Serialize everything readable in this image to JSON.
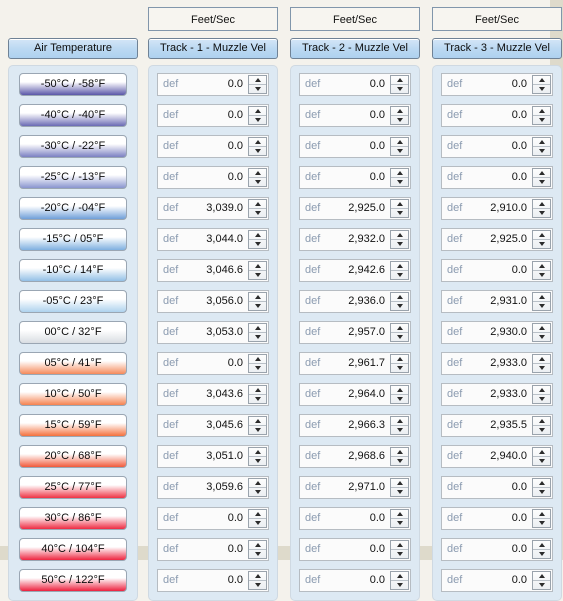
{
  "columns": {
    "temperature": {
      "header": "Air Temperature",
      "units": "",
      "rows": [
        {
          "label": "-50°C / -58°F",
          "grad_top": "#ffffff",
          "grad_bottom": "#5a57a8"
        },
        {
          "label": "-40°C / -40°F",
          "grad_top": "#ffffff",
          "grad_bottom": "#6a6ab4"
        },
        {
          "label": "-30°C / -22°F",
          "grad_top": "#ffffff",
          "grad_bottom": "#7b80c2"
        },
        {
          "label": "-25°C / -13°F",
          "grad_top": "#ffffff",
          "grad_bottom": "#8a95cf"
        },
        {
          "label": "-20°C / -04°F",
          "grad_top": "#ffffff",
          "grad_bottom": "#6f9fd8"
        },
        {
          "label": "-15°C /  05°F",
          "grad_top": "#ffffff",
          "grad_bottom": "#7fb0e0"
        },
        {
          "label": "-10°C /  14°F",
          "grad_top": "#ffffff",
          "grad_bottom": "#93c0e6"
        },
        {
          "label": "-05°C /  23°F",
          "grad_top": "#ffffff",
          "grad_bottom": "#aed2ee"
        },
        {
          "label": "00°C /  32°F",
          "grad_top": "#ffffff",
          "grad_bottom": "#d8dde2"
        },
        {
          "label": "05°C /  41°F",
          "grad_top": "#ffffff",
          "grad_bottom": "#f58a5a"
        },
        {
          "label": "10°C /  50°F",
          "grad_top": "#ffffff",
          "grad_bottom": "#f5824f"
        },
        {
          "label": "15°C /  59°F",
          "grad_top": "#ffffff",
          "grad_bottom": "#f4703c"
        },
        {
          "label": "20°C /  68°F",
          "grad_top": "#ffffff",
          "grad_bottom": "#f15a3a"
        },
        {
          "label": "25°C /  77°F",
          "grad_top": "#ffffff",
          "grad_bottom": "#ef3344"
        },
        {
          "label": "30°C /  86°F",
          "grad_top": "#ffffff",
          "grad_bottom": "#ee2b42"
        },
        {
          "label": "40°C / 104°F",
          "grad_top": "#ffffff",
          "grad_bottom": "#ee2640"
        },
        {
          "label": "50°C / 122°F",
          "grad_top": "#ffffff",
          "grad_bottom": "#ed213e"
        }
      ]
    },
    "tracks": [
      {
        "units": "Feet/Sec",
        "header": "Track - 1 - Muzzle Vel",
        "prefix": "def",
        "values": [
          "0.0",
          "0.0",
          "0.0",
          "0.0",
          "3,039.0",
          "3,044.0",
          "3,046.6",
          "3,056.0",
          "3,053.0",
          "0.0",
          "3,043.6",
          "3,045.6",
          "3,051.0",
          "3,059.6",
          "0.0",
          "0.0",
          "0.0"
        ]
      },
      {
        "units": "Feet/Sec",
        "header": "Track - 2 - Muzzle Vel",
        "prefix": "def",
        "values": [
          "0.0",
          "0.0",
          "0.0",
          "0.0",
          "2,925.0",
          "2,932.0",
          "2,942.6",
          "2,936.0",
          "2,957.0",
          "2,961.7",
          "2,964.0",
          "2,966.3",
          "2,968.6",
          "2,971.0",
          "0.0",
          "0.0",
          "0.0"
        ]
      },
      {
        "units": "Feet/Sec",
        "header": "Track - 3 - Muzzle Vel",
        "prefix": "def",
        "values": [
          "0.0",
          "0.0",
          "0.0",
          "0.0",
          "2,910.0",
          "2,925.0",
          "0.0",
          "2,931.0",
          "2,930.0",
          "2,933.0",
          "2,933.0",
          "2,935.5",
          "2,940.0",
          "0.0",
          "0.0",
          "0.0",
          "0.0"
        ]
      }
    ]
  },
  "colors": {
    "page_background": "#f4f2ec",
    "panel_background": "#dde9f3",
    "header_button": "#bcd9f2",
    "accent_border": "#6f8296"
  }
}
